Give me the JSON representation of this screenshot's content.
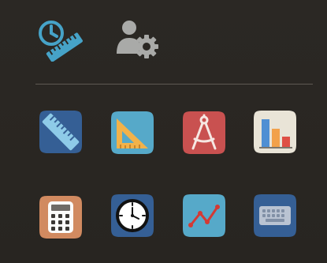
{
  "screen": {
    "background": "#2a2723"
  },
  "header_icons": [
    {
      "name": "clock-ruler-icon",
      "color": "#46a3c8"
    },
    {
      "name": "user-settings-icon",
      "color": "#a9aaa8"
    }
  ],
  "apps": [
    {
      "id": "ruler",
      "icon": "ruler-icon",
      "bg": "#355f95"
    },
    {
      "id": "set-square",
      "icon": "set-square-icon",
      "bg": "#56a9c9"
    },
    {
      "id": "compass",
      "icon": "compass-icon",
      "bg": "#c95150"
    },
    {
      "id": "bar-chart",
      "icon": "bar-chart-icon",
      "bg": "#e9e4d7"
    },
    {
      "id": "calculator",
      "icon": "calculator-icon",
      "bg": "#d18a60"
    },
    {
      "id": "clock",
      "icon": "clock-icon",
      "bg": "#355f95"
    },
    {
      "id": "line-graph",
      "icon": "line-graph-icon",
      "bg": "#56a9c9"
    },
    {
      "id": "keyboard",
      "icon": "keyboard-icon",
      "bg": "#355f95"
    }
  ]
}
